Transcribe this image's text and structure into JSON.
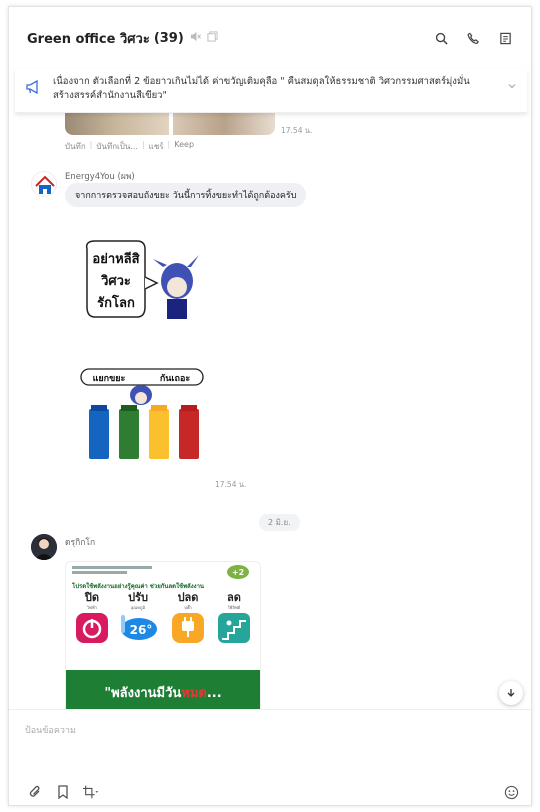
{
  "header": {
    "title": "Green office วิศวะ",
    "member_count": "(39)",
    "icons": [
      "mute-icon",
      "copy-icon",
      "search-icon",
      "phone-icon",
      "notes-icon"
    ]
  },
  "announcement": {
    "icon": "megaphone-icon",
    "text": "เนื่องจาก ตัวเลือกที่ 2 ข้อยาวเกินไม่ได้ ค่าขวัญเติมคุลือ \" คืนสมดุลให้ธรรมชาติ วิศวกรรมศาสตร์มุ่งมั่น สร้างสรรค์สำนักงานสีเขียว\""
  },
  "prev_message": {
    "time": "17.54 น.",
    "actions": [
      "บันทึก",
      "บันทึกเป็น...",
      "แชร์",
      "Keep"
    ]
  },
  "message1": {
    "sender": "Energy4You (ผพ)",
    "text": "จากการตรวจสอบถังขยะ วันนี้การทิ้งขยะทำได้ถูกต้องครับ",
    "sticker1_text": [
      "อย่าหลีสิ",
      "วิศวะ",
      "รักโลก"
    ],
    "sticker2_text": [
      "แยกขยะ",
      "กันเถอะ"
    ],
    "time": "17.54 น."
  },
  "date_divider": "2 มิ.ย.",
  "message2": {
    "sender": "ดรุกิกโก",
    "poster": {
      "title": "โปรดใช้พลังงานอย่างรู้คุณค่า ช่วยกันลดใช้พลังงาน",
      "items": [
        {
          "word": "ปิด",
          "sub": "ไฟฟ้า",
          "color": "#d81b60"
        },
        {
          "word": "ปรับ",
          "sub": "อุณหภูมิ",
          "color": "#1e88e5"
        },
        {
          "word": "ปลด",
          "sub": "ปลั๊ก",
          "color": "#f9a825"
        },
        {
          "word": "ลด",
          "sub": "ใช้ลิฟต์",
          "color": "#26a69a"
        }
      ],
      "temp": "26°",
      "slogan_a": "\"พลังงานมีวัน",
      "slogan_b": "หมด",
      "slogan_c": "..."
    }
  },
  "input": {
    "placeholder": "ป้อนข้อความ"
  },
  "toolbar_icons": [
    "attachment-icon",
    "bookmark-icon",
    "crop-icon",
    "emoji-icon"
  ]
}
